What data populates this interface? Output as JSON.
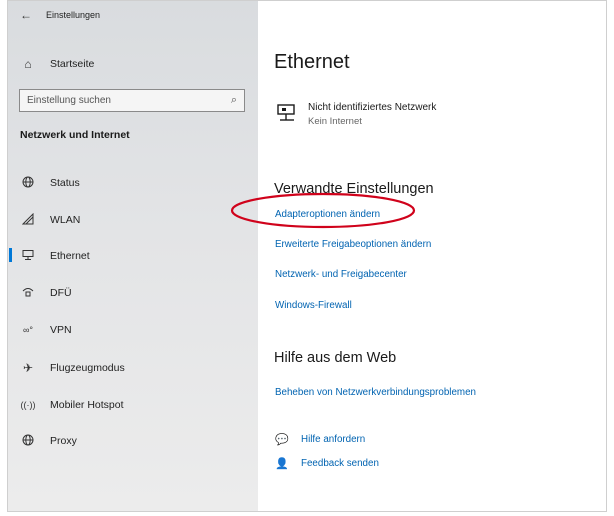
{
  "window": {
    "title": "Einstellungen"
  },
  "sidebar": {
    "home_label": "Startseite",
    "search_placeholder": "Einstellung suchen",
    "section_heading": "Netzwerk und Internet",
    "items": [
      {
        "label": "Status",
        "icon": "globe-icon",
        "selected": false
      },
      {
        "label": "WLAN",
        "icon": "wifi-icon",
        "selected": false
      },
      {
        "label": "Ethernet",
        "icon": "ethernet-icon",
        "selected": true
      },
      {
        "label": "DFÜ",
        "icon": "dialup-icon",
        "selected": false
      },
      {
        "label": "VPN",
        "icon": "vpn-icon",
        "selected": false
      },
      {
        "label": "Flugzeugmodus",
        "icon": "airplane-icon",
        "selected": false
      },
      {
        "label": "Mobiler Hotspot",
        "icon": "hotspot-icon",
        "selected": false
      },
      {
        "label": "Proxy",
        "icon": "globe-icon",
        "selected": false
      }
    ]
  },
  "main": {
    "title": "Ethernet",
    "network": {
      "name": "Nicht identifiziertes Netzwerk",
      "status": "Kein Internet",
      "icon": "network-icon"
    },
    "related": {
      "heading": "Verwandte Einstellungen",
      "links": [
        "Adapteroptionen ändern",
        "Erweiterte Freigabeoptionen ändern",
        "Netzwerk- und Freigabecenter",
        "Windows-Firewall"
      ]
    },
    "web_help": {
      "heading": "Hilfe aus dem Web",
      "links": [
        "Beheben von Netzwerkverbindungsproblemen"
      ]
    },
    "help_actions": [
      {
        "label": "Hilfe anfordern",
        "icon": "help-chat-icon"
      },
      {
        "label": "Feedback senden",
        "icon": "feedback-icon"
      }
    ]
  },
  "colors": {
    "accent": "#0078d7",
    "link": "#0063b1",
    "annotation": "#d0021b"
  }
}
